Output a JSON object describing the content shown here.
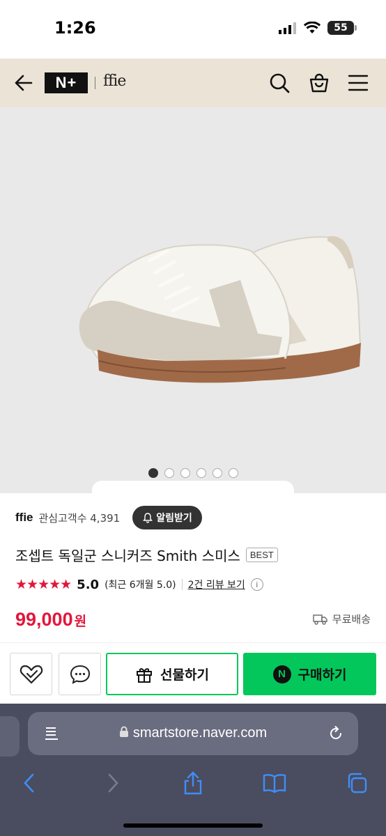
{
  "status": {
    "time": "1:26",
    "battery": "55"
  },
  "header": {
    "nplus": "N+",
    "brand_logo": "ffie"
  },
  "carousel": {
    "total": 6,
    "active_index": 0
  },
  "seller": {
    "name": "ffie",
    "followers": "관심고객수 4,391",
    "alarm_label": "알림받기"
  },
  "product": {
    "title": "조셉트 독일군 스니커즈 Smith 스미스",
    "badge": "BEST",
    "stars": "★★★★★",
    "score": "5.0",
    "recent": "(최근 6개월 5.0)",
    "review_link": "2건 리뷰 보기",
    "price": "99,000",
    "price_unit": "원",
    "shipping": "무료배송"
  },
  "actions": {
    "gift_label": "선물하기",
    "buy_label": "구매하기",
    "buy_badge": "N"
  },
  "browser": {
    "url": "smartstore.naver.com"
  },
  "colors": {
    "accent_red": "#e2163b",
    "naver_green": "#03c75a",
    "header_beige": "#ece3d7"
  }
}
